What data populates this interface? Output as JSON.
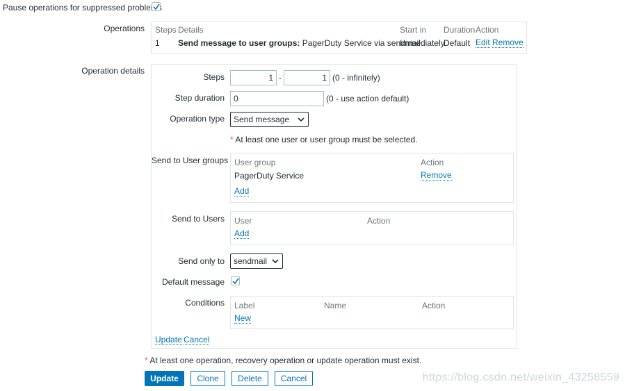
{
  "pause": {
    "label": "Pause operations for suppressed problems",
    "checked": true
  },
  "operations": {
    "label": "Operations",
    "headers": [
      "Steps",
      "Details",
      "Start in",
      "Duration",
      "Action"
    ],
    "row": {
      "steps": "1",
      "details_bold": "Send message to user groups:",
      "details_rest": "PagerDuty Service via sendmail",
      "start_in": "Immediately",
      "duration": "Default",
      "edit": "Edit",
      "remove": "Remove"
    }
  },
  "details": {
    "label": "Operation details",
    "steps_label": "Steps",
    "steps_from": "1",
    "steps_sep": "-",
    "steps_to": "1",
    "steps_hint": "(0 - infinitely)",
    "step_duration_label": "Step duration",
    "step_duration_value": "0",
    "step_duration_hint": "(0 - use action default)",
    "operation_type_label": "Operation type",
    "operation_type_value": "Send message",
    "req_star": "*",
    "req_msg": "At least one user or user group must be selected.",
    "user_groups_label": "Send to User groups",
    "user_groups_headers": [
      "User group",
      "Action"
    ],
    "user_group_name": "PagerDuty Service",
    "user_group_remove": "Remove",
    "user_groups_add": "Add",
    "users_label": "Send to Users",
    "users_headers": [
      "User",
      "Action"
    ],
    "users_add": "Add",
    "send_only_label": "Send only to",
    "send_only_value": "sendmail",
    "default_message_label": "Default message",
    "default_message_checked": true,
    "conditions_label": "Conditions",
    "conditions_headers": [
      "Label",
      "Name",
      "Action"
    ],
    "conditions_new": "New",
    "update_link": "Update",
    "cancel_link": "Cancel"
  },
  "footer": {
    "req_star": "*",
    "req_msg": "At least one operation, recovery operation or update operation must exist.",
    "buttons": {
      "update": "Update",
      "clone": "Clone",
      "delete": "Delete",
      "cancel": "Cancel"
    }
  },
  "watermark": "https://blog.csdn.net/weixin_43258559"
}
